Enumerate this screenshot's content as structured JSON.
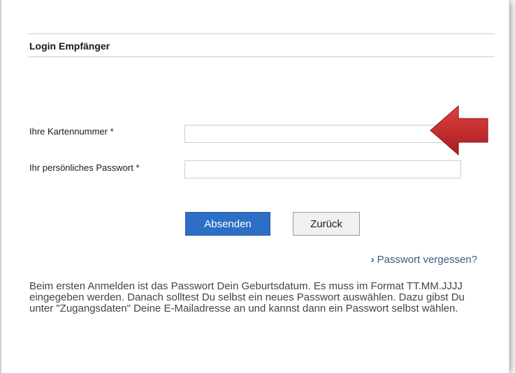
{
  "header": {
    "title": "Login Empfänger"
  },
  "form": {
    "card_label": "Ihre Kartennummer *",
    "card_value": "",
    "password_label": "Ihr persönliches Passwort *",
    "password_value": ""
  },
  "actions": {
    "submit_label": "Absenden",
    "back_label": "Zurück"
  },
  "links": {
    "forgot_password": "Passwort vergessen?"
  },
  "info": {
    "text": "Beim ersten Anmelden ist das Passwort Dein Geburtsdatum. Es muss im Format TT.MM.JJJJ eingegeben werden. Danach solltest Du selbst ein neues Passwort auswählen. Dazu gibst Du unter \"Zugangsdaten\" Deine E-Mailadresse an und kannst dann ein Passwort selbst wählen."
  },
  "icons": {
    "arrow": "red-arrow-icon",
    "chevron": "chevron-right-icon"
  },
  "colors": {
    "primary_button": "#2d6fc4",
    "link": "#3d5a80",
    "arrow": "#c9282d"
  }
}
